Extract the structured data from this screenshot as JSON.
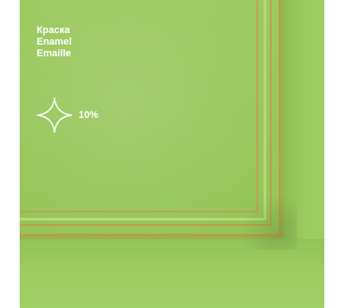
{
  "labels": {
    "ru": "Краска",
    "en": "Enamel",
    "fr": "Emaille"
  },
  "gloss": {
    "icon": "sparkle-icon",
    "value": "10%"
  },
  "colors": {
    "paint": "#9bc960",
    "text": "#ffffff",
    "edge_highlight": "#c69a52"
  }
}
